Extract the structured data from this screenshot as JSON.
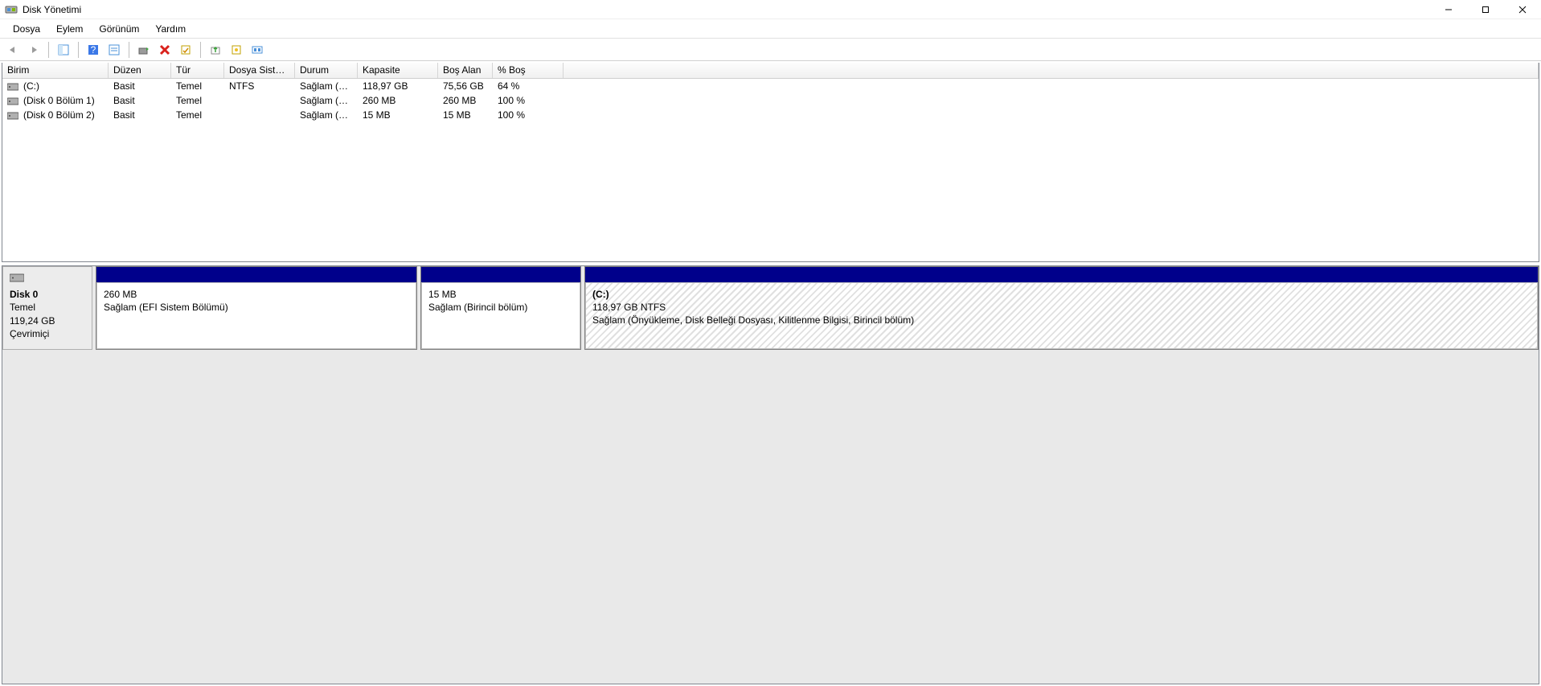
{
  "window": {
    "title": "Disk Yönetimi"
  },
  "menu": {
    "items": [
      "Dosya",
      "Eylem",
      "Görünüm",
      "Yardım"
    ]
  },
  "volume_list": {
    "columns": [
      "Birim",
      "Düzen",
      "Tür",
      "Dosya Siste…",
      "Durum",
      "Kapasite",
      "Boş Alan",
      "% Boş"
    ],
    "rows": [
      {
        "name": "(C:)",
        "layout": "Basit",
        "type": "Temel",
        "fs": "NTFS",
        "status": "Sağlam (Ö…",
        "capacity": "118,97 GB",
        "free": "75,56 GB",
        "pct": "64 %"
      },
      {
        "name": "(Disk 0 Bölüm 1)",
        "layout": "Basit",
        "type": "Temel",
        "fs": "",
        "status": "Sağlam (E…",
        "capacity": "260 MB",
        "free": "260 MB",
        "pct": "100 %"
      },
      {
        "name": "(Disk 0 Bölüm 2)",
        "layout": "Basit",
        "type": "Temel",
        "fs": "",
        "status": "Sağlam (Bi…",
        "capacity": "15 MB",
        "free": "15 MB",
        "pct": "100 %"
      }
    ]
  },
  "graphical": {
    "disk": {
      "title": "Disk 0",
      "type": "Temel",
      "size": "119,24 GB",
      "status": "Çevrimiçi"
    },
    "partitions": [
      {
        "name": "",
        "size": "260 MB",
        "status": "Sağlam (EFI Sistem Bölümü)",
        "flex": 400,
        "hatched": false
      },
      {
        "name": "",
        "size": "15 MB",
        "status": "Sağlam (Birincil bölüm)",
        "flex": 200,
        "hatched": false
      },
      {
        "name": "(C:)",
        "size": "118,97 GB NTFS",
        "status": "Sağlam (Önyükleme, Disk Belleği Dosyası, Kilitlenme Bilgisi, Birincil bölüm)",
        "flex": 847,
        "hatched": true
      }
    ]
  }
}
